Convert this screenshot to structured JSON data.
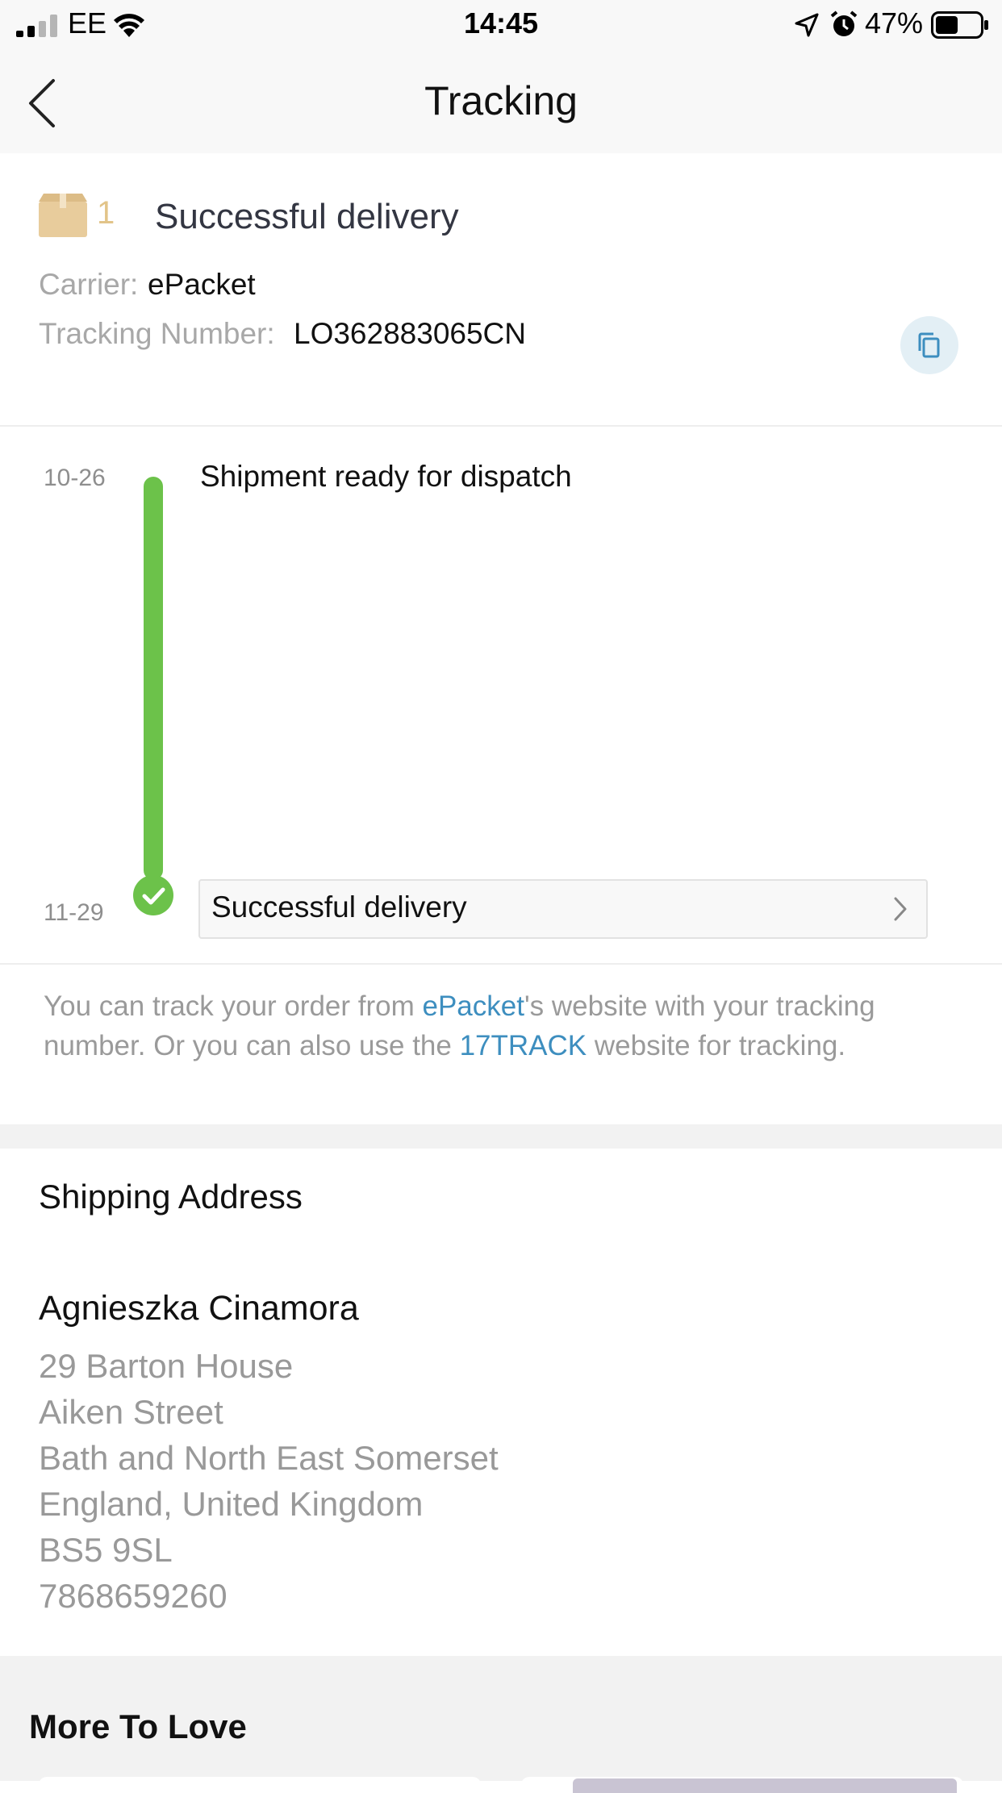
{
  "status_bar": {
    "carrier": "EE",
    "time": "14:45",
    "battery": "47%"
  },
  "nav": {
    "title": "Tracking"
  },
  "package": {
    "count": "1",
    "status": "Successful delivery",
    "carrier_label": "Carrier:",
    "carrier_value": "ePacket",
    "tracking_label": "Tracking Number:",
    "tracking_value": "LO362883065CN"
  },
  "timeline": {
    "events": [
      {
        "date": "10-26",
        "text": "Shipment ready for dispatch"
      },
      {
        "date": "11-29",
        "text": "Successful delivery"
      }
    ],
    "line_color": "#6cc24a"
  },
  "info": {
    "part1": "You can track your order from ",
    "link1": "ePacket",
    "part2": "'s website with your tracking number. Or you can also use the ",
    "link2": "17TRACK",
    "part3": " website for tracking."
  },
  "shipping": {
    "heading": "Shipping Address",
    "name": "Agnieszka Cinamora",
    "lines": [
      "29 Barton House",
      "Aiken Street",
      "Bath and North East Somerset",
      "England, United Kingdom",
      "BS5 9SL",
      "7868659260"
    ]
  },
  "more": {
    "heading": "More To Love"
  },
  "icons": [
    "signal-icon",
    "wifi-icon",
    "location-arrow-icon",
    "alarm-icon",
    "battery-icon",
    "back-chevron-icon",
    "package-box-icon",
    "copy-icon",
    "check-circle-icon",
    "chevron-right-icon"
  ]
}
